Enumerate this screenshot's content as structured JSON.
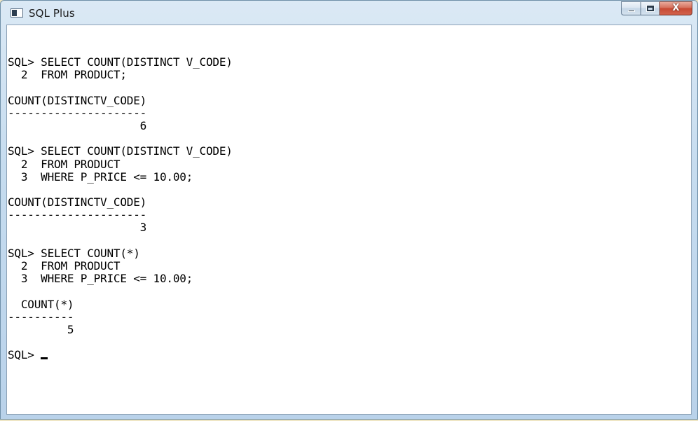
{
  "window": {
    "title": "SQL Plus",
    "icon": "console-window-icon",
    "controls": {
      "minimize_icon": "minimize-icon",
      "maximize_icon": "maximize-icon",
      "close_glyph": "X"
    }
  },
  "console": {
    "lines": [
      "SQL> SELECT COUNT(DISTINCT V_CODE)",
      "  2  FROM PRODUCT;",
      "",
      "COUNT(DISTINCTV_CODE)",
      "---------------------",
      "                    6",
      "",
      "SQL> SELECT COUNT(DISTINCT V_CODE)",
      "  2  FROM PRODUCT",
      "  3  WHERE P_PRICE <= 10.00;",
      "",
      "COUNT(DISTINCTV_CODE)",
      "---------------------",
      "                    3",
      "",
      "SQL> SELECT COUNT(*)",
      "  2  FROM PRODUCT",
      "  3  WHERE P_PRICE <= 10.00;",
      "",
      "  COUNT(*)",
      "----------",
      "         5",
      ""
    ],
    "prompt": "SQL> "
  }
}
